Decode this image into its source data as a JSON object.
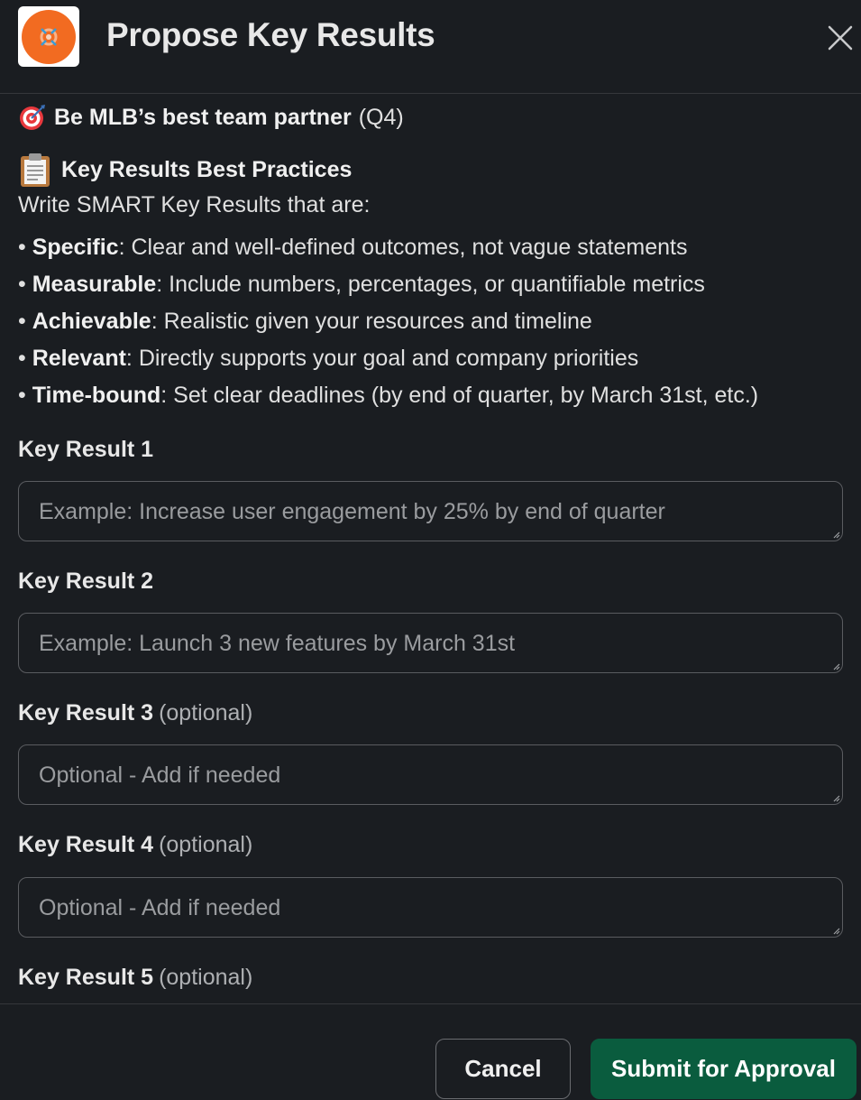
{
  "header": {
    "title": "Propose Key Results",
    "app_icon": "orange-app-logo",
    "close_icon": "close-icon"
  },
  "goal": {
    "icon": "dart-target-emoji",
    "name": "Be MLB’s best team partner",
    "suffix": "(Q4)"
  },
  "best_practices": {
    "icon": "clipboard-emoji",
    "title": "Key Results Best Practices",
    "intro": "Write SMART Key Results that are:",
    "items": [
      {
        "term": "Specific",
        "text": ": Clear and well-defined outcomes, not vague statements"
      },
      {
        "term": "Measurable",
        "text": ": Include numbers, percentages, or quantifiable metrics"
      },
      {
        "term": "Achievable",
        "text": ": Realistic given your resources and timeline"
      },
      {
        "term": "Relevant",
        "text": ": Directly supports your goal and company priorities"
      },
      {
        "term": "Time-bound",
        "text": ": Set clear deadlines (by end of quarter, by March 31st, etc.)"
      }
    ]
  },
  "fields": [
    {
      "label": "Key Result 1",
      "optional": "",
      "placeholder": "Example: Increase user engagement by 25% by end of quarter",
      "value": ""
    },
    {
      "label": "Key Result 2",
      "optional": "",
      "placeholder": "Example: Launch 3 new features by March 31st",
      "value": ""
    },
    {
      "label": "Key Result 3",
      "optional": "(optional)",
      "placeholder": "Optional - Add if needed",
      "value": ""
    },
    {
      "label": "Key Result 4",
      "optional": "(optional)",
      "placeholder": "Optional - Add if needed",
      "value": ""
    },
    {
      "label": "Key Result 5",
      "optional": "(optional)",
      "placeholder": "",
      "value": ""
    }
  ],
  "footer": {
    "cancel_label": "Cancel",
    "submit_label": "Submit for Approval"
  },
  "colors": {
    "background": "#1a1d21",
    "primary_button": "#0a5c3e",
    "app_icon_orange": "#f26b21"
  }
}
